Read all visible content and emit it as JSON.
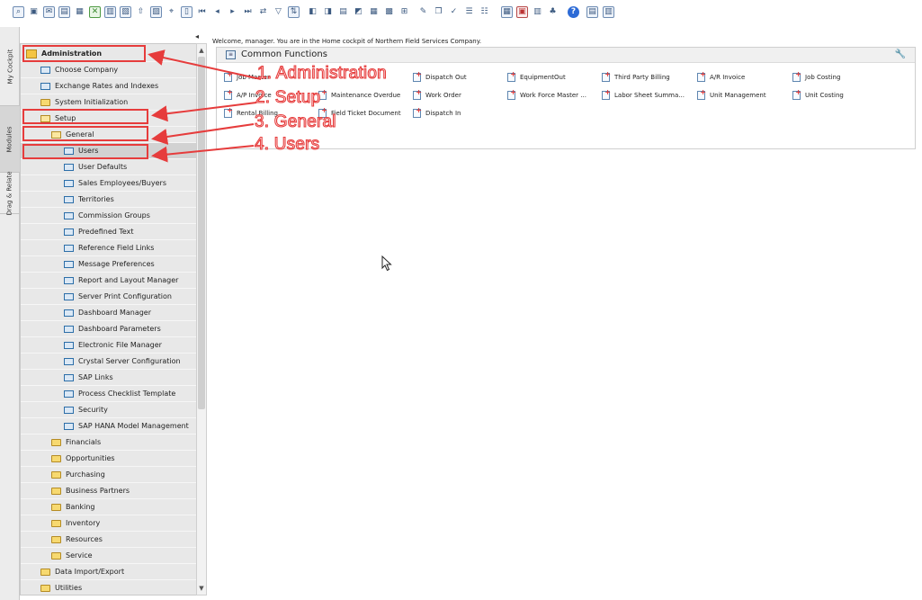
{
  "toolbar": {
    "icons": [
      "print-preview-icon",
      "print-icon",
      "email-icon",
      "export-pdf-icon",
      "export-excel-icon",
      "export-word-icon",
      "lock-icon",
      "unlock-icon",
      "up-icon",
      "document-icon",
      "find-icon",
      "add-icon",
      "first-record-icon",
      "previous-record-icon",
      "next-record-icon",
      "last-record-icon",
      "refresh-icon",
      "filter-icon",
      "sort-icon",
      "base-document-icon",
      "target-document-icon",
      "gross-profit-icon",
      "journal-icon",
      "payment-icon",
      "relation-map-icon",
      "settings-icon",
      "edit-icon",
      "copy-icon",
      "approve-icon",
      "messages-icon",
      "alerts-icon",
      "calculator-icon",
      "calendar-icon",
      "spreadsheet-icon",
      "org-chart-icon",
      "help-icon",
      "window-icon",
      "layout-icon"
    ]
  },
  "side_tabs": {
    "my_cockpit": "My Cockpit",
    "modules": "Modules",
    "drag_relate": "Drag & Relate"
  },
  "tree": {
    "admin": "Administration",
    "choose_company": "Choose Company",
    "exchange_rates": "Exchange Rates and Indexes",
    "system_init": "System Initialization",
    "setup": "Setup",
    "general": "General",
    "general_items": [
      "Users",
      "User Defaults",
      "Sales Employees/Buyers",
      "Territories",
      "Commission Groups",
      "Predefined Text",
      "Reference Field Links",
      "Message Preferences",
      "Report and Layout Manager",
      "Server Print Configuration",
      "Dashboard Manager",
      "Dashboard Parameters",
      "Electronic File Manager",
      "Crystal Server Configuration",
      "SAP Links",
      "Process Checklist Template",
      "Security",
      "SAP HANA Model Management"
    ],
    "setup_folders": [
      "Financials",
      "Opportunities",
      "Purchasing",
      "Business Partners",
      "Banking",
      "Inventory",
      "Resources",
      "Service"
    ],
    "data_import": "Data Import/Export",
    "utilities": "Utilities"
  },
  "welcome": "Welcome, manager. You are in the Home cockpit of Northern Field Services Company.",
  "common_functions": {
    "title": "Common Functions",
    "items": [
      [
        "Job Master",
        "Dispatch Out",
        "EquipmentOut",
        "Third Party Billing",
        "A/R Invoice",
        "Job Costing"
      ],
      [
        "A/P Invoice",
        "Maintenance Overdue",
        "Work Order",
        "Work Force Master ...",
        "Labor Sheet Summa...",
        "Unit Management",
        "Unit Costing"
      ],
      [
        "Rental Billing",
        "Field Ticket Document",
        "Dispatch In"
      ]
    ]
  },
  "annotations": {
    "step1": "1. Administration",
    "step2": "2. Setup",
    "step3": "3. General",
    "step4": "4. Users",
    "color": "#e63c3c"
  }
}
